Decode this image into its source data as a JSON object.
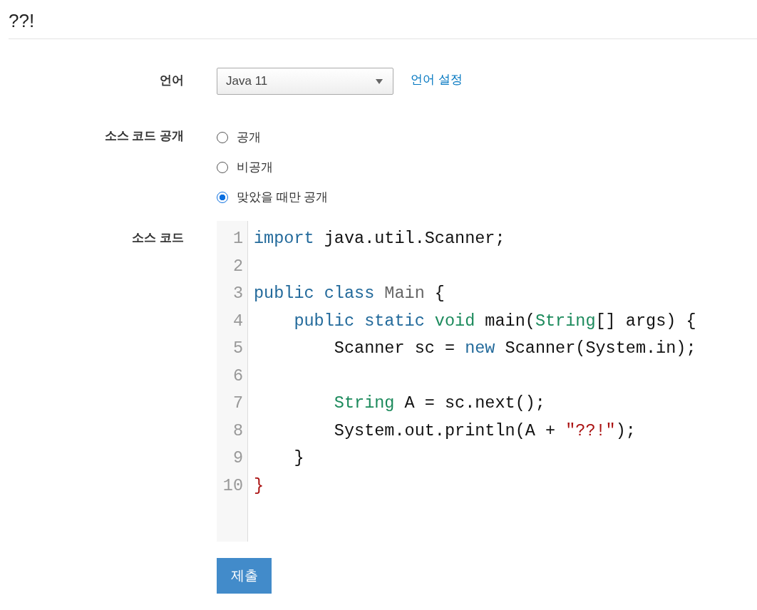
{
  "page_title": "??!",
  "language": {
    "label": "언어",
    "value": "Java 11",
    "link": "언어 설정"
  },
  "visibility": {
    "label": "소스 코드 공개",
    "options": [
      {
        "label": "공개",
        "selected": false
      },
      {
        "label": "비공개",
        "selected": false
      },
      {
        "label": "맞았을 때만 공개",
        "selected": true
      }
    ]
  },
  "source": {
    "label": "소스 코드",
    "lines": [
      {
        "number": "1",
        "tokens": [
          {
            "kind": "keyword",
            "text": "import"
          },
          {
            "kind": "plain",
            "text": " java.util.Scanner;"
          }
        ]
      },
      {
        "number": "2"
      },
      {
        "number": "3",
        "tokens": [
          {
            "kind": "keyword",
            "text": "public class "
          },
          {
            "kind": "def",
            "text": "Main"
          },
          {
            "kind": "plain",
            "text": " {"
          }
        ]
      },
      {
        "number": "4",
        "tokens": [
          {
            "kind": "keyword",
            "text": "    public static "
          },
          {
            "kind": "type",
            "text": "void"
          },
          {
            "kind": "plain",
            "text": " main("
          },
          {
            "kind": "type",
            "text": "String"
          },
          {
            "kind": "plain",
            "text": "[] args) {"
          }
        ]
      },
      {
        "number": "5",
        "tokens": [
          {
            "kind": "plain",
            "text": "        Scanner sc = "
          },
          {
            "kind": "keyword",
            "text": "new"
          },
          {
            "kind": "plain",
            "text": " Scanner(System.in);"
          }
        ]
      },
      {
        "number": "6"
      },
      {
        "number": "7",
        "tokens": [
          {
            "kind": "type",
            "text": "        String"
          },
          {
            "kind": "plain",
            "text": " A = sc.next();"
          }
        ]
      },
      {
        "number": "8",
        "tokens": [
          {
            "kind": "plain",
            "text": "        System.out.println(A + "
          },
          {
            "kind": "string",
            "text": "\"??!\""
          },
          {
            "kind": "plain",
            "text": ");"
          }
        ]
      },
      {
        "number": "9",
        "tokens": [
          {
            "kind": "plain",
            "text": "    }"
          }
        ]
      },
      {
        "number": "10",
        "tokens": [
          {
            "kind": "bracket",
            "text": "}"
          }
        ]
      }
    ]
  },
  "submit": "제출"
}
